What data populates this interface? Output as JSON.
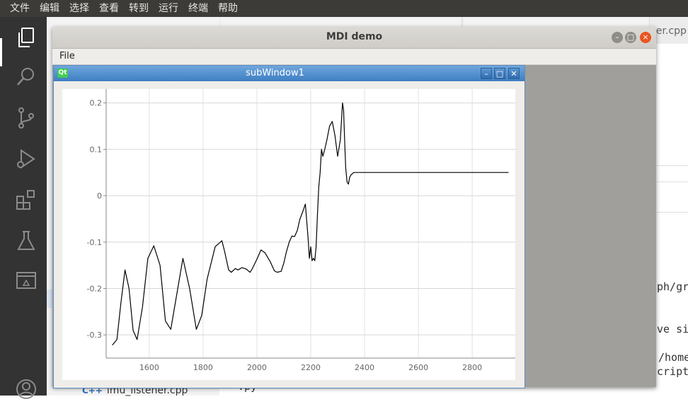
{
  "ide": {
    "menu": [
      "文件",
      "编辑",
      "选择",
      "查看",
      "转到",
      "运行",
      "终端",
      "帮助"
    ],
    "tab_right_fragment": "ner.cpp",
    "code_fragments": [
      "ph/gra",
      "ve sig",
      "/home",
      "cript/",
      ".py"
    ],
    "sidebar_file": "imu_listener.cpp",
    "sidebar_file_icon": "C++"
  },
  "mdi": {
    "title": "MDI demo",
    "menu_file": "File"
  },
  "subwindow": {
    "title": "subWindow1",
    "icon_text": "Qt"
  },
  "chart_data": {
    "type": "line",
    "xlim": [
      1440,
      2960
    ],
    "ylim": [
      -0.35,
      0.23
    ],
    "x_ticks": [
      1600,
      1800,
      2000,
      2200,
      2400,
      2600,
      2800
    ],
    "y_ticks": [
      0.2,
      0.1,
      0,
      -0.1,
      -0.2,
      -0.3
    ],
    "x_tick_labels": [
      "1600",
      "1800",
      "2000",
      "2200",
      "2400",
      "2600",
      "2800"
    ],
    "y_tick_labels": [
      "0.2",
      "0.1",
      "0",
      "-0.1",
      "-0.2",
      "-0.3"
    ],
    "grid": true,
    "line_color": "#000000",
    "series": [
      {
        "x": [
          1463,
          1480,
          1495,
          1510,
          1525,
          1540,
          1555,
          1575,
          1595,
          1617,
          1640,
          1660,
          1680,
          1700,
          1725,
          1750,
          1775,
          1795,
          1815,
          1845,
          1870,
          1880,
          1895,
          1905,
          1920,
          1930,
          1945,
          1960,
          1975,
          1985,
          2000,
          2015,
          2030,
          2050,
          2065,
          2075,
          2090,
          2100,
          2110,
          2120,
          2130,
          2140,
          2150,
          2160,
          2170,
          2180,
          2190,
          2195,
          2200,
          2205,
          2210,
          2215,
          2220,
          2225,
          2230,
          2235,
          2240,
          2245,
          2252,
          2260,
          2270,
          2280,
          2290,
          2300,
          2310,
          2318,
          2322,
          2326,
          2330,
          2335,
          2340,
          2345,
          2350,
          2360,
          2370,
          2380,
          2400,
          2500,
          2600,
          2700,
          2800,
          2900,
          2935
        ],
        "y": [
          -0.322,
          -0.31,
          -0.23,
          -0.16,
          -0.2,
          -0.29,
          -0.31,
          -0.24,
          -0.135,
          -0.108,
          -0.15,
          -0.27,
          -0.288,
          -0.22,
          -0.135,
          -0.2,
          -0.288,
          -0.258,
          -0.18,
          -0.11,
          -0.097,
          -0.12,
          -0.16,
          -0.165,
          -0.157,
          -0.16,
          -0.155,
          -0.158,
          -0.165,
          -0.155,
          -0.137,
          -0.117,
          -0.123,
          -0.143,
          -0.162,
          -0.165,
          -0.163,
          -0.145,
          -0.12,
          -0.1,
          -0.087,
          -0.088,
          -0.075,
          -0.05,
          -0.035,
          -0.018,
          -0.09,
          -0.135,
          -0.11,
          -0.14,
          -0.135,
          -0.14,
          -0.11,
          -0.04,
          0.02,
          0.05,
          0.1,
          0.085,
          0.1,
          0.12,
          0.15,
          0.16,
          0.13,
          0.085,
          0.12,
          0.2,
          0.185,
          0.12,
          0.06,
          0.03,
          0.025,
          0.04,
          0.045,
          0.05,
          0.05,
          0.05,
          0.05,
          0.05,
          0.05,
          0.05,
          0.05,
          0.05,
          0.05
        ]
      }
    ]
  }
}
